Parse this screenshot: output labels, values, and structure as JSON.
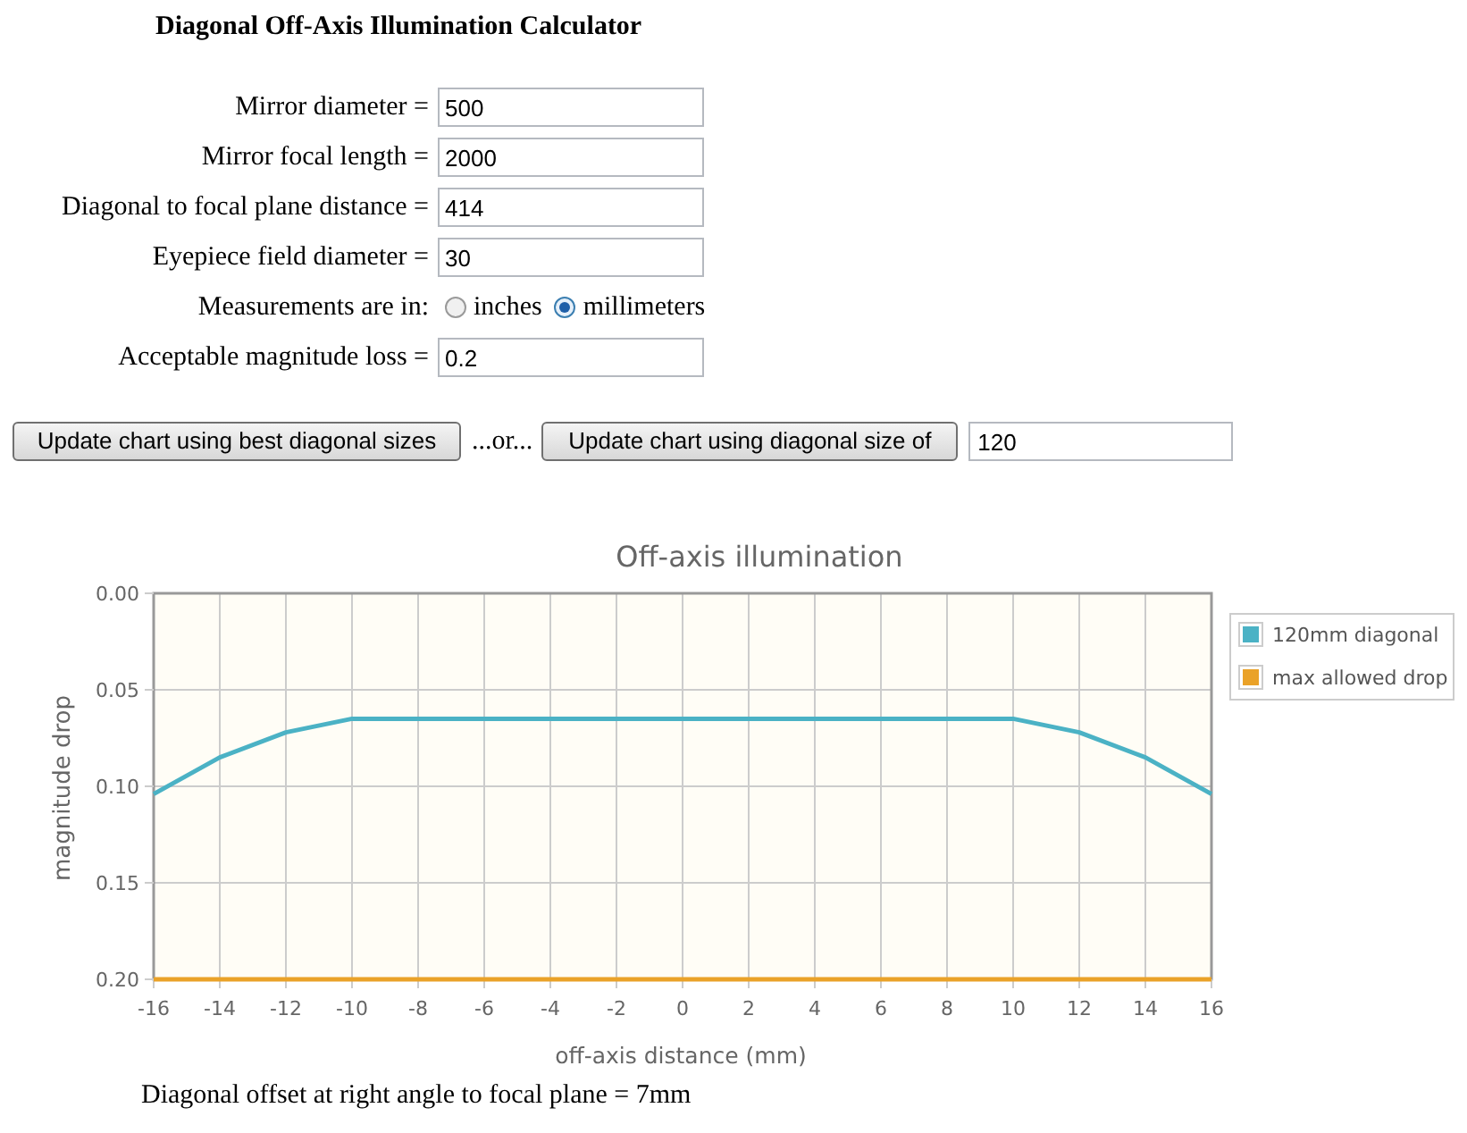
{
  "title": "Diagonal Off-Axis Illumination Calculator",
  "form_rows": [
    {
      "kind": "field",
      "label": "Mirror diameter =",
      "value": "500"
    },
    {
      "kind": "field",
      "label": "Mirror focal length =",
      "value": "2000"
    },
    {
      "kind": "field",
      "label": "Diagonal to focal plane distance =",
      "value": "414"
    },
    {
      "kind": "field",
      "label": "Eyepiece field diameter =",
      "value": "30"
    },
    {
      "kind": "radio",
      "label": "Measurements are in:",
      "options": [
        {
          "label": "inches",
          "selected": false
        },
        {
          "label": "millimeters",
          "selected": true
        }
      ]
    },
    {
      "kind": "field",
      "label": "Acceptable magnitude loss =",
      "value": "0.2"
    }
  ],
  "actions": {
    "best_button": "Update chart using best diagonal sizes",
    "separator": "...or...",
    "size_button": "Update chart using diagonal size of",
    "size_value": "120"
  },
  "chart": {
    "chart_data": {
      "type": "line",
      "title": "Off-axis illumination",
      "xlabel": "off-axis distance (mm)",
      "ylabel": "magnitude drop",
      "x": [
        -16,
        -14,
        -12,
        -10,
        -8,
        -6,
        -4,
        -2,
        0,
        2,
        4,
        6,
        8,
        10,
        12,
        14,
        16
      ],
      "series": [
        {
          "name": "120mm diagonal",
          "color": "#4bb2c5",
          "values": [
            0.104,
            0.085,
            0.072,
            0.065,
            0.065,
            0.065,
            0.065,
            0.065,
            0.065,
            0.065,
            0.065,
            0.065,
            0.065,
            0.065,
            0.072,
            0.085,
            0.104
          ]
        },
        {
          "name": "max allowed drop",
          "color": "#eaa228",
          "values": [
            0.2,
            0.2,
            0.2,
            0.2,
            0.2,
            0.2,
            0.2,
            0.2,
            0.2,
            0.2,
            0.2,
            0.2,
            0.2,
            0.2,
            0.2,
            0.2,
            0.2
          ]
        }
      ],
      "xlim": [
        -16,
        16
      ],
      "ylim": [
        0.2,
        0
      ],
      "xticks": [
        -16,
        -14,
        -12,
        -10,
        -8,
        -6,
        -4,
        -2,
        0,
        2,
        4,
        6,
        8,
        10,
        12,
        14,
        16
      ],
      "yticks": [
        {
          "value": 0,
          "label": "0.00"
        },
        {
          "value": 0.05,
          "label": "0.05"
        },
        {
          "value": 0.1,
          "label": "0.10"
        },
        {
          "value": 0.15,
          "label": "0.15"
        },
        {
          "value": 0.2,
          "label": "0.20"
        }
      ],
      "grid": true,
      "legend": true
    }
  },
  "result": "Diagonal offset at right angle to focal plane = 7mm"
}
